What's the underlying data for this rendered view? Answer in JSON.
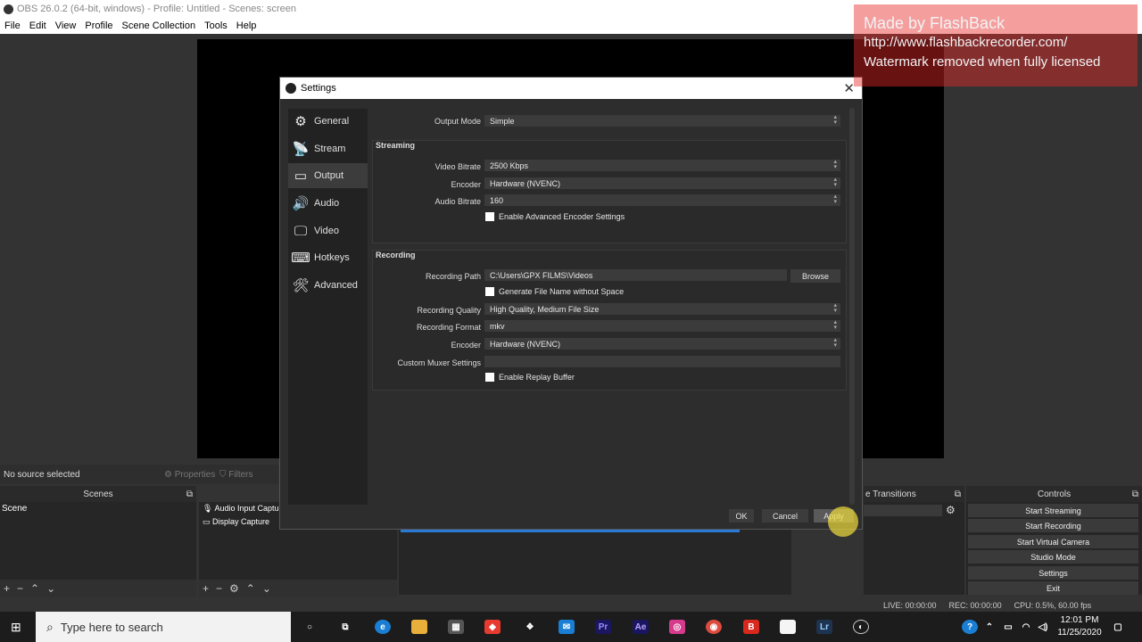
{
  "window": {
    "title": "OBS 26.0.2 (64-bit, windows) - Profile: Untitled - Scenes: screen"
  },
  "menu": [
    "File",
    "Edit",
    "View",
    "Profile",
    "Scene Collection",
    "Tools",
    "Help"
  ],
  "source_bar": {
    "status": "No source selected",
    "properties": "Properties",
    "filters": "Filters"
  },
  "docks": {
    "scenes_title": "Scenes",
    "scenes": [
      "Scene"
    ],
    "sources": [
      "Audio Input Captur",
      "Display Capture"
    ],
    "transitions_title": "e Transitions",
    "controls_title": "Controls",
    "controls": [
      "Start Streaming",
      "Start Recording",
      "Start Virtual Camera",
      "Studio Mode",
      "Settings",
      "Exit"
    ]
  },
  "status": {
    "live": "LIVE: 00:00:00",
    "rec": "REC: 00:00:00",
    "cpu": "CPU: 0.5%, 60.00 fps"
  },
  "settings": {
    "title": "Settings",
    "nav": [
      {
        "label": "General",
        "icon": "gear-icon"
      },
      {
        "label": "Stream",
        "icon": "antenna-icon"
      },
      {
        "label": "Output",
        "icon": "monitor-output-icon"
      },
      {
        "label": "Audio",
        "icon": "speaker-icon"
      },
      {
        "label": "Video",
        "icon": "monitor-icon"
      },
      {
        "label": "Hotkeys",
        "icon": "keyboard-icon"
      },
      {
        "label": "Advanced",
        "icon": "tools-icon"
      }
    ],
    "output_mode_label": "Output Mode",
    "output_mode": "Simple",
    "streaming": {
      "title": "Streaming",
      "video_bitrate_label": "Video Bitrate",
      "video_bitrate": "2500 Kbps",
      "encoder_label": "Encoder",
      "encoder": "Hardware (NVENC)",
      "audio_bitrate_label": "Audio Bitrate",
      "audio_bitrate": "160",
      "advanced_encoder": "Enable Advanced Encoder Settings"
    },
    "recording": {
      "title": "Recording",
      "path_label": "Recording Path",
      "path": "C:\\Users\\GPX FILMS\\Videos",
      "browse": "Browse",
      "gen_filename": "Generate File Name without Space",
      "quality_label": "Recording Quality",
      "quality": "High Quality, Medium File Size",
      "format_label": "Recording Format",
      "format": "mkv",
      "encoder_label": "Encoder",
      "encoder": "Hardware (NVENC)",
      "muxer_label": "Custom Muxer Settings",
      "muxer": "",
      "replay_buffer": "Enable Replay Buffer"
    },
    "buttons": {
      "ok": "OK",
      "cancel": "Cancel",
      "apply": "Apply"
    }
  },
  "watermark": {
    "line1": "Made by FlashBack",
    "line2": "http://www.flashbackrecorder.com/",
    "line3": "Watermark removed when fully licensed"
  },
  "taskbar": {
    "search_placeholder": "Type here to search",
    "time": "12:01 PM",
    "date": "11/25/2020"
  }
}
